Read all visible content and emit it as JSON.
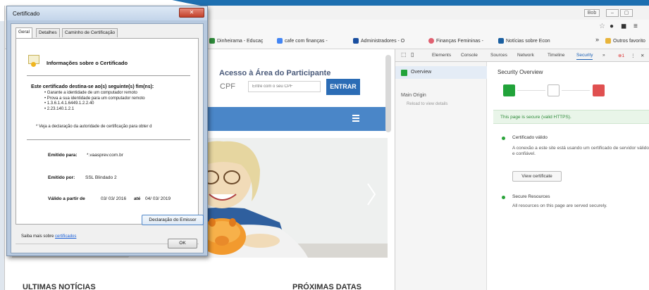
{
  "browser": {
    "window_buttons": [
      "Bob",
      "–",
      "▢"
    ],
    "bookmarks": [
      {
        "label": "Dinheirama - Educaç",
        "color": "#2e8b3a"
      },
      {
        "label": "cafe com finanças - ",
        "color": "#4285f4"
      },
      {
        "label": "Administradores - O",
        "color": "#1a4fa0"
      },
      {
        "label": "Finanças Femininas -",
        "color": "#e06070"
      },
      {
        "label": "Notícias sobre Econ",
        "color": "#1a5fa0"
      },
      {
        "label": "Outros favorito",
        "color": "#e8b43a"
      }
    ],
    "bookmark_more": "»"
  },
  "page": {
    "login_title": "Acesso à Área do Participante",
    "cpf_label": "CPF",
    "cpf_placeholder": "Entre com o seu CPF",
    "enter_button": "ENTRAR",
    "news_title": "ULTIMAS NOTÍCIAS",
    "dates_title": "PRÓXIMAS DATAS"
  },
  "devtools": {
    "tabs": [
      "Elements",
      "Console",
      "Sources",
      "Network",
      "Timeline",
      "Security",
      "»"
    ],
    "active_tab": "Security",
    "error_count": "1",
    "sidebar": {
      "overview": "Overview",
      "main_origin": "Main Origin",
      "reload_hint": "Reload to view details"
    },
    "main": {
      "title": "Security Overview",
      "https_message": "This page is secure (valid HTTPS).",
      "cert_title": "Certificado válido",
      "cert_desc": "A conexão a este site está usando um certificado de servidor válido e confiável.",
      "view_cert_button": "View certificate",
      "resources_title": "Secure Resources",
      "resources_desc": "All resources on this page are served securely."
    }
  },
  "cert_dialog": {
    "title": "Certificado",
    "close": "✕",
    "tabs": [
      "Geral",
      "Detalhes",
      "Caminho de Certificação"
    ],
    "info_title": "Informações sobre o Certificado",
    "purpose_title": "Este certificado destina-se ao(s) seguinte(s) fim(ns):",
    "purposes": [
      "Garante a identidade de um computador remoto",
      "Prova a sua identidade para um computador remoto",
      "1.3.6.1.4.1.6449.1.2.2.40",
      "2.23.140.1.2.1"
    ],
    "note": "* Veja a declaração da autoridade de certificação para obter d",
    "issued_to_label": "Emitido para:",
    "issued_to_value": "*.vaasprev.com.br",
    "issued_by_label": "Emitido por:",
    "issued_by_value": "SSL Blindado 2",
    "valid_from_label": "Válido a partir de",
    "valid_from_value": "03/ 03/ 2016",
    "valid_to_label": "até",
    "valid_to_value": "04/ 03/ 2019",
    "issuer_button": "Declaração do Emissor",
    "learn_more_text": "Saiba mais sobre",
    "learn_more_link": "certificados",
    "ok_button": "OK"
  },
  "colors": {
    "banner": "#1d6fb0",
    "entrar": "#2b6cb5",
    "navbar": "#4a86c8",
    "secure_green": "#21a33a",
    "insecure_red": "#e05050"
  }
}
